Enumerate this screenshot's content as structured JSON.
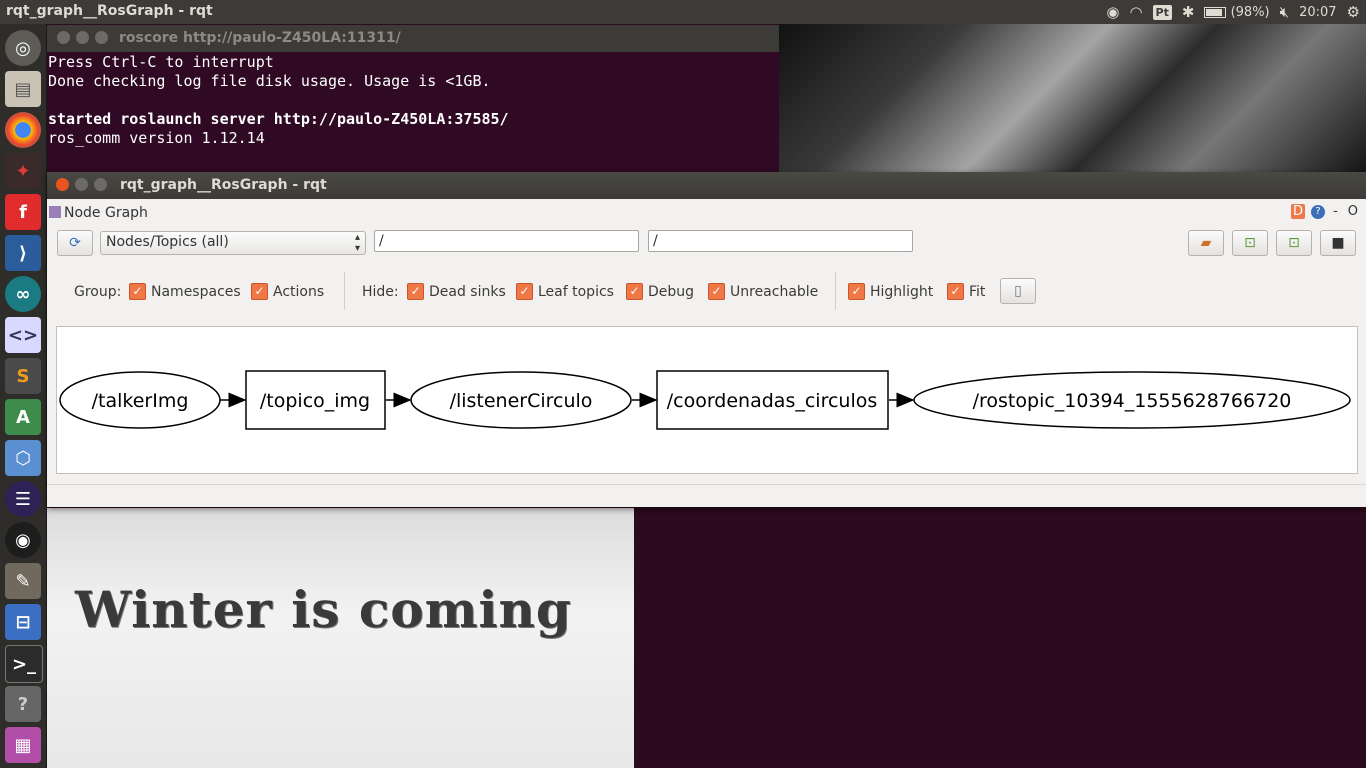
{
  "top_panel": {
    "title": "rqt_graph__RosGraph - rqt",
    "battery": "(98%)",
    "clock": "20:07",
    "pt_label": "Pt"
  },
  "launcher": {
    "items": [
      "ubuntu-dash",
      "files",
      "chrome",
      "app-red",
      "foxit",
      "vscode",
      "arduino",
      "code-editor",
      "sublime",
      "android-studio",
      "virtualbox",
      "eclipse",
      "obs",
      "gimp",
      "ide",
      "terminal",
      "help",
      "workspace"
    ]
  },
  "terminal": {
    "title": "roscore http://paulo-Z450LA:11311/",
    "lines": [
      "Press Ctrl-C to interrupt",
      "Done checking log file disk usage. Usage is <1GB.",
      "",
      "started roslaunch server http://paulo-Z450LA:37585/",
      "ros_comm version 1.12.14"
    ]
  },
  "rqt": {
    "title": "rqt_graph__RosGraph - rqt",
    "dock_title": "Node Graph",
    "dock_controls": {
      "help": "D",
      "minus": "-",
      "close": "O"
    },
    "filter_select": "Nodes/Topics (all)",
    "ns_filter": "/",
    "topic_filter": "/",
    "group_label": "Group:",
    "group_options": [
      "Namespaces",
      "Actions"
    ],
    "hide_label": "Hide:",
    "hide_options": [
      "Dead sinks",
      "Leaf topics",
      "Debug",
      "Unreachable"
    ],
    "view_options": [
      "Highlight",
      "Fit"
    ]
  },
  "graph": {
    "nodes": [
      {
        "id": "n1",
        "label": "/talkerImg",
        "shape": "ellipse"
      },
      {
        "id": "n2",
        "label": "/topico_img",
        "shape": "box"
      },
      {
        "id": "n3",
        "label": "/listenerCirculo",
        "shape": "ellipse"
      },
      {
        "id": "n4",
        "label": "/coordenadas_circulos",
        "shape": "box"
      },
      {
        "id": "n5",
        "label": "/rostopic_10394_1555628766720",
        "shape": "ellipse"
      }
    ]
  },
  "wallpaper": {
    "text": "Winter is coming"
  }
}
